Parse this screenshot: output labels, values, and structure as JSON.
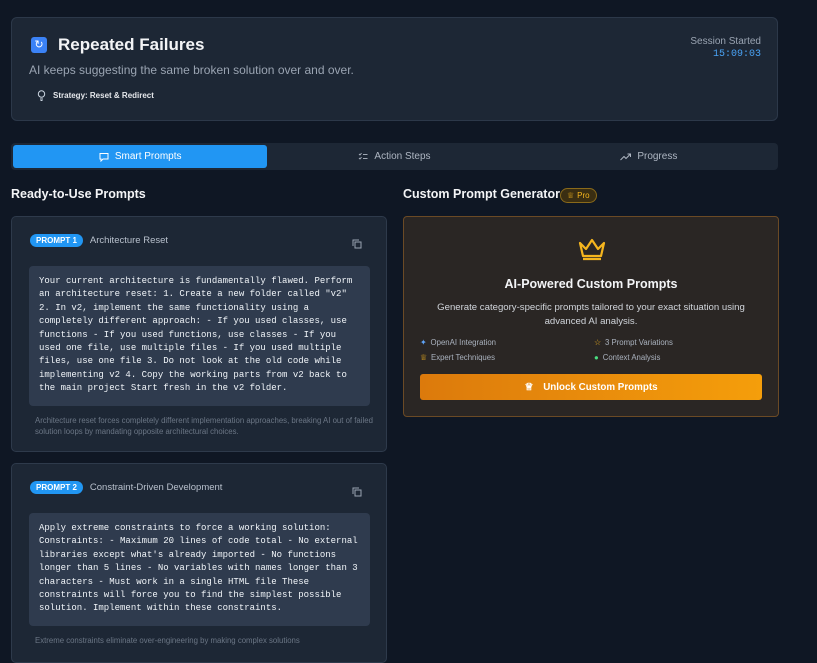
{
  "header": {
    "icon": "refresh-icon",
    "title": "Repeated Failures",
    "subtitle": "AI keeps suggesting the same broken solution over and over.",
    "strategy": "Strategy: Reset & Redirect",
    "session_label": "Session Started",
    "session_time": "15:09:03"
  },
  "tabs": [
    {
      "label": "Smart Prompts",
      "icon": "chat-icon",
      "active": true
    },
    {
      "label": "Action Steps",
      "icon": "checklist-icon",
      "active": false
    },
    {
      "label": "Progress",
      "icon": "trend-icon",
      "active": false
    }
  ],
  "left": {
    "title": "Ready-to-Use Prompts",
    "prompts": [
      {
        "badge": "PROMPT 1",
        "name": "Architecture Reset",
        "code": "Your current architecture is fundamentally flawed. Perform an architecture reset: 1. Create a new folder called \"v2\" 2. In v2, implement the same functionality using a completely different approach: - If you used classes, use functions - If you used functions, use classes - If you used one file, use multiple files - If you used multiple files, use one file 3. Do not look at the old code while implementing v2 4. Copy the working parts from v2 back to the main project Start fresh in the v2 folder.",
        "note": "Architecture reset forces completely different implementation approaches, breaking AI out of failed solution loops by mandating opposite architectural choices."
      },
      {
        "badge": "PROMPT 2",
        "name": "Constraint-Driven Development",
        "code": "Apply extreme constraints to force a working solution: Constraints: - Maximum 20 lines of code total - No external libraries except what's already imported - No functions longer than 5 lines - No variables with names longer than 3 characters - Must work in a single HTML file These constraints will force you to find the simplest possible solution. Implement within these constraints.",
        "note": "Extreme constraints eliminate over-engineering by making complex solutions"
      }
    ]
  },
  "right": {
    "title": "Custom Prompt Generator",
    "pro_label": "Pro",
    "gen_title": "AI-Powered Custom Prompts",
    "gen_desc": "Generate category-specific prompts tailored to your exact situation using advanced AI analysis.",
    "features": [
      {
        "label": "OpenAI Integration",
        "icon": "sparkle-icon"
      },
      {
        "label": "3 Prompt Variations",
        "icon": "star-icon"
      },
      {
        "label": "Expert Techniques",
        "icon": "crown-icon"
      },
      {
        "label": "Context Analysis",
        "icon": "bulb-icon"
      }
    ],
    "button": "Unlock Custom Prompts",
    "accent": "#f59e0b"
  }
}
